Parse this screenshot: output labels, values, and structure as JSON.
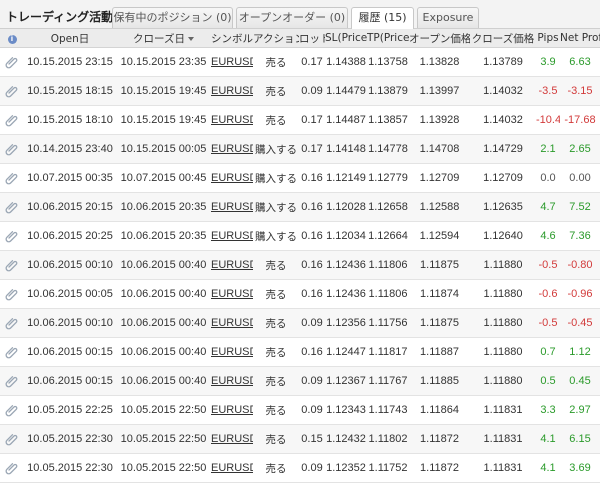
{
  "panel_title": "トレーディング活動",
  "tabs": [
    {
      "label": "保有中のポジション (0)",
      "active": false
    },
    {
      "label": "オープンオーダー (0)",
      "active": false
    },
    {
      "label": "履歴 (15)",
      "active": true
    },
    {
      "label": "Exposure",
      "active": false
    }
  ],
  "headers": {
    "info": "i",
    "open_date": "Open日",
    "close_date": "クローズ日",
    "symbol": "シンボル",
    "action": "アクション",
    "lot": "ロット",
    "sl": "SL(Price)",
    "tp": "TP(Price)",
    "open_price": "オープン価格",
    "close_price": "クローズ価格",
    "pips": "Pips",
    "net_profit": "Net Profit"
  },
  "icons": {
    "header": "info-icon",
    "row": "paperclip-icon"
  },
  "colors": {
    "positive": "#2a9a2a",
    "negative": "#d23a3a",
    "neutral": "#555555"
  },
  "rows": [
    {
      "open": "10.15.2015 23:15",
      "close": "10.15.2015 23:35",
      "symbol": "EURUSD",
      "action": "売る",
      "lot": "0.17",
      "sl": "1.14388",
      "tp": "1.13758",
      "open_price": "1.13828",
      "close_price": "1.13789",
      "pips": "3.9",
      "net": "6.63",
      "sign": "pos"
    },
    {
      "open": "10.15.2015 18:15",
      "close": "10.15.2015 19:45",
      "symbol": "EURUSD",
      "action": "売る",
      "lot": "0.09",
      "sl": "1.14479",
      "tp": "1.13879",
      "open_price": "1.13997",
      "close_price": "1.14032",
      "pips": "-3.5",
      "net": "-3.15",
      "sign": "neg"
    },
    {
      "open": "10.15.2015 18:10",
      "close": "10.15.2015 19:45",
      "symbol": "EURUSD",
      "action": "売る",
      "lot": "0.17",
      "sl": "1.14487",
      "tp": "1.13857",
      "open_price": "1.13928",
      "close_price": "1.14032",
      "pips": "-10.4",
      "net": "-17.68",
      "sign": "neg"
    },
    {
      "open": "10.14.2015 23:40",
      "close": "10.15.2015 00:05",
      "symbol": "EURUSD",
      "action": "購入する",
      "lot": "0.17",
      "sl": "1.14148",
      "tp": "1.14778",
      "open_price": "1.14708",
      "close_price": "1.14729",
      "pips": "2.1",
      "net": "2.65",
      "sign": "pos"
    },
    {
      "open": "10.07.2015 00:35",
      "close": "10.07.2015 00:45",
      "symbol": "EURUSD",
      "action": "購入する",
      "lot": "0.16",
      "sl": "1.12149",
      "tp": "1.12779",
      "open_price": "1.12709",
      "close_price": "1.12709",
      "pips": "0.0",
      "net": "0.00",
      "sign": "zero"
    },
    {
      "open": "10.06.2015 20:15",
      "close": "10.06.2015 20:35",
      "symbol": "EURUSD",
      "action": "購入する",
      "lot": "0.16",
      "sl": "1.12028",
      "tp": "1.12658",
      "open_price": "1.12588",
      "close_price": "1.12635",
      "pips": "4.7",
      "net": "7.52",
      "sign": "pos"
    },
    {
      "open": "10.06.2015 20:25",
      "close": "10.06.2015 20:35",
      "symbol": "EURUSD",
      "action": "購入する",
      "lot": "0.16",
      "sl": "1.12034",
      "tp": "1.12664",
      "open_price": "1.12594",
      "close_price": "1.12640",
      "pips": "4.6",
      "net": "7.36",
      "sign": "pos"
    },
    {
      "open": "10.06.2015 00:10",
      "close": "10.06.2015 00:40",
      "symbol": "EURUSD",
      "action": "売る",
      "lot": "0.16",
      "sl": "1.12436",
      "tp": "1.11806",
      "open_price": "1.11875",
      "close_price": "1.11880",
      "pips": "-0.5",
      "net": "-0.80",
      "sign": "neg"
    },
    {
      "open": "10.06.2015 00:05",
      "close": "10.06.2015 00:40",
      "symbol": "EURUSD",
      "action": "売る",
      "lot": "0.16",
      "sl": "1.12436",
      "tp": "1.11806",
      "open_price": "1.11874",
      "close_price": "1.11880",
      "pips": "-0.6",
      "net": "-0.96",
      "sign": "neg"
    },
    {
      "open": "10.06.2015 00:10",
      "close": "10.06.2015 00:40",
      "symbol": "EURUSD",
      "action": "売る",
      "lot": "0.09",
      "sl": "1.12356",
      "tp": "1.11756",
      "open_price": "1.11875",
      "close_price": "1.11880",
      "pips": "-0.5",
      "net": "-0.45",
      "sign": "neg"
    },
    {
      "open": "10.06.2015 00:15",
      "close": "10.06.2015 00:40",
      "symbol": "EURUSD",
      "action": "売る",
      "lot": "0.16",
      "sl": "1.12447",
      "tp": "1.11817",
      "open_price": "1.11887",
      "close_price": "1.11880",
      "pips": "0.7",
      "net": "1.12",
      "sign": "pos"
    },
    {
      "open": "10.06.2015 00:15",
      "close": "10.06.2015 00:40",
      "symbol": "EURUSD",
      "action": "売る",
      "lot": "0.09",
      "sl": "1.12367",
      "tp": "1.11767",
      "open_price": "1.11885",
      "close_price": "1.11880",
      "pips": "0.5",
      "net": "0.45",
      "sign": "pos"
    },
    {
      "open": "10.05.2015 22:25",
      "close": "10.05.2015 22:50",
      "symbol": "EURUSD",
      "action": "売る",
      "lot": "0.09",
      "sl": "1.12343",
      "tp": "1.11743",
      "open_price": "1.11864",
      "close_price": "1.11831",
      "pips": "3.3",
      "net": "2.97",
      "sign": "pos"
    },
    {
      "open": "10.05.2015 22:30",
      "close": "10.05.2015 22:50",
      "symbol": "EURUSD",
      "action": "売る",
      "lot": "0.15",
      "sl": "1.12432",
      "tp": "1.11802",
      "open_price": "1.11872",
      "close_price": "1.11831",
      "pips": "4.1",
      "net": "6.15",
      "sign": "pos"
    },
    {
      "open": "10.05.2015 22:30",
      "close": "10.05.2015 22:50",
      "symbol": "EURUSD",
      "action": "売る",
      "lot": "0.09",
      "sl": "1.12352",
      "tp": "1.11752",
      "open_price": "1.11872",
      "close_price": "1.11831",
      "pips": "4.1",
      "net": "3.69",
      "sign": "pos"
    }
  ]
}
